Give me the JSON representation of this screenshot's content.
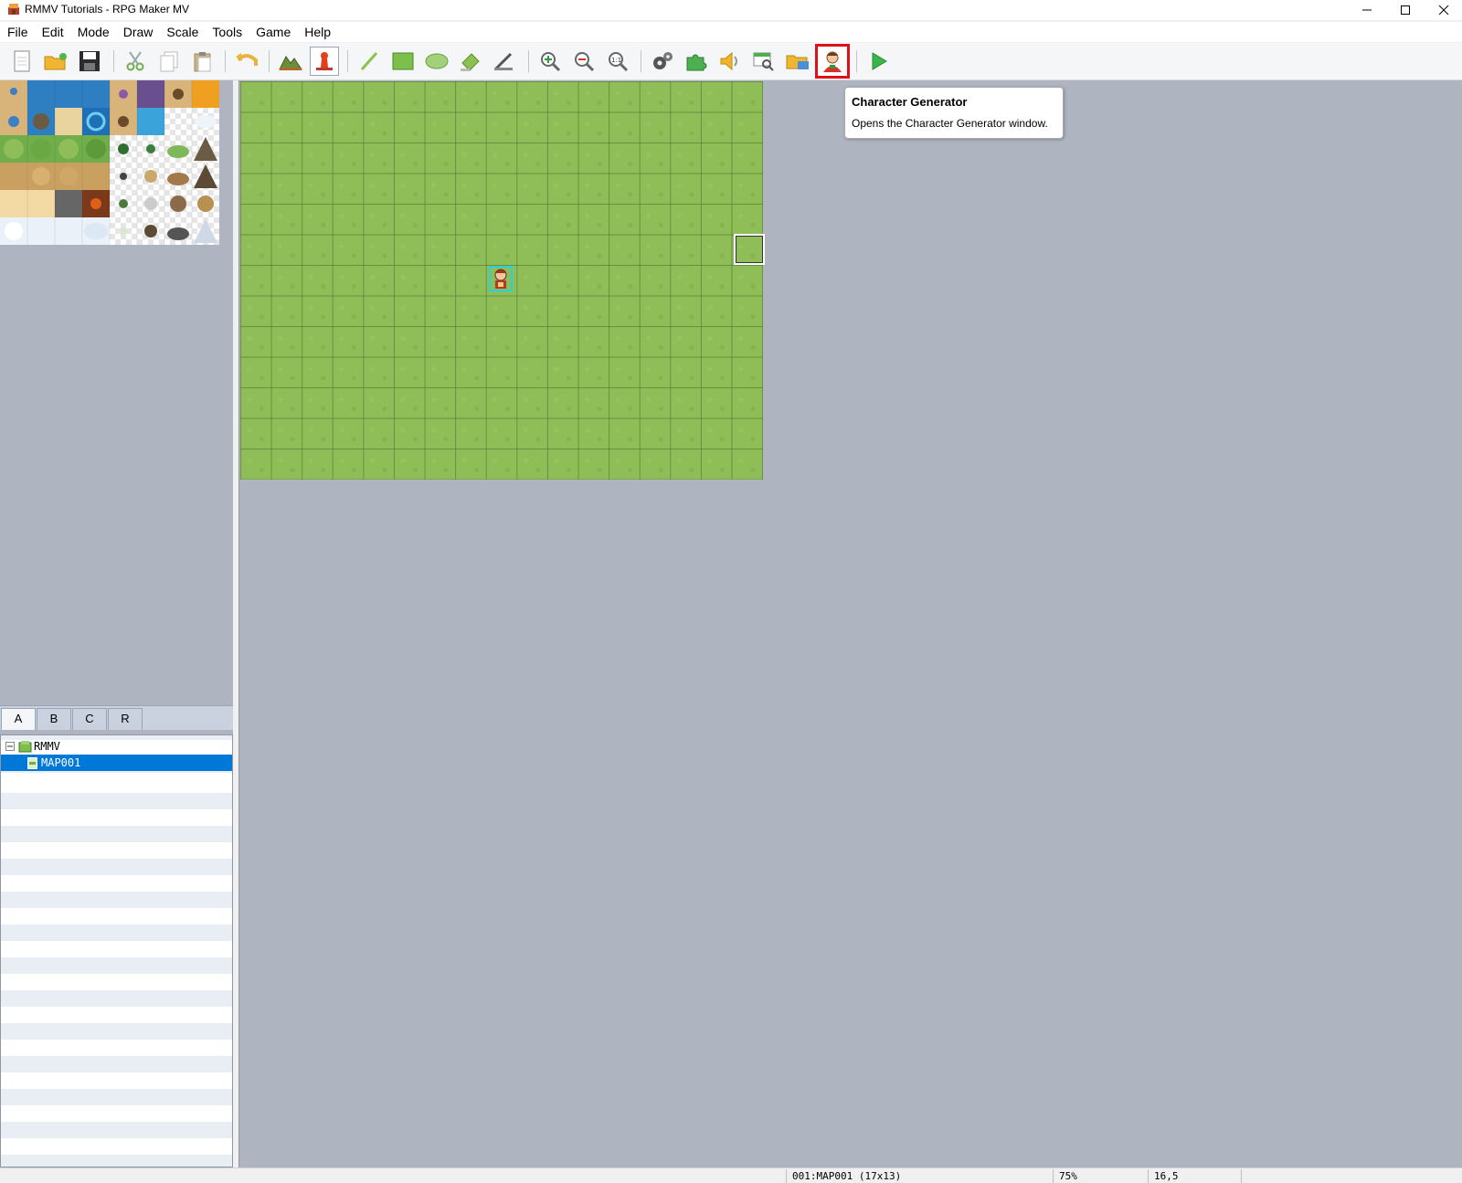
{
  "window": {
    "title": "RMMV Tutorials - RPG Maker MV"
  },
  "menu": [
    "File",
    "Edit",
    "Mode",
    "Draw",
    "Scale",
    "Tools",
    "Game",
    "Help"
  ],
  "toolbar": {
    "buttons": [
      "new-project",
      "open-project",
      "save-project",
      "cut",
      "copy",
      "paste",
      "undo",
      "map-mode",
      "event-mode",
      "pencil",
      "rectangle",
      "ellipse",
      "fill",
      "shadow-pen",
      "zoom-in",
      "zoom-out",
      "actual-size",
      "database",
      "plugin-manager",
      "sound-test",
      "event-searcher",
      "resource-manager",
      "character-generator",
      "playtest"
    ],
    "highlighted": "character-generator"
  },
  "tooltip": {
    "title": "Character Generator",
    "description": "Opens the Character Generator window."
  },
  "tileset_tabs": [
    "A",
    "B",
    "C",
    "R"
  ],
  "selected_tab": "A",
  "map_tree": {
    "project": "RMMV Tutorials",
    "maps": [
      "MAP001"
    ],
    "selected": "MAP001"
  },
  "map": {
    "width_tiles": 17,
    "height_tiles": 13
  },
  "status": {
    "map_info": "001:MAP001 (17x13)",
    "zoom": "75%",
    "coords": "16,5"
  },
  "colors": {
    "grass": "#8fbd58",
    "canvas_bg": "#aeb5c1",
    "highlight": "#e0101a",
    "selection": "#0078d7"
  }
}
